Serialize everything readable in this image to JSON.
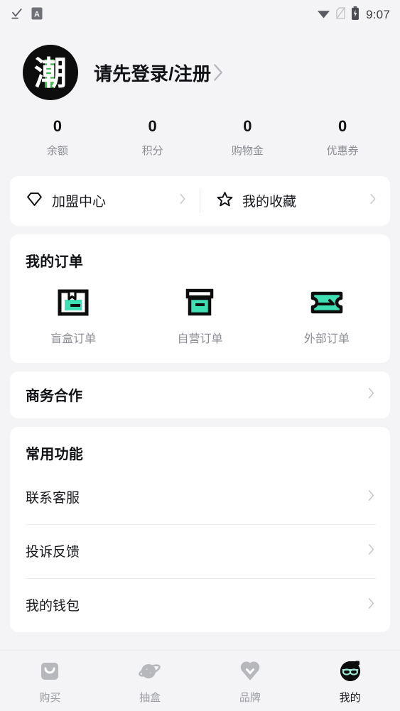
{
  "status_bar": {
    "icons_left": [
      "download-complete-icon",
      "app-badge-a-icon"
    ],
    "app_badge_letter": "A",
    "icons_right": [
      "wifi-icon",
      "no-sim-icon",
      "battery-charging-icon"
    ],
    "time": "9:07"
  },
  "profile": {
    "avatar_char": "潮",
    "avatar_bg": "#0d0d0d",
    "avatar_accent": "#3ebb4d",
    "login_label": "请先登录/注册",
    "chevron": "chevron-right-icon"
  },
  "stats": [
    {
      "value": "0",
      "label": "余额"
    },
    {
      "value": "0",
      "label": "积分"
    },
    {
      "value": "0",
      "label": "购物金"
    },
    {
      "value": "0",
      "label": "优惠券"
    }
  ],
  "quick_links": [
    {
      "label": "加盟中心",
      "icon": "diamond-icon"
    },
    {
      "label": "我的收藏",
      "icon": "star-icon"
    }
  ],
  "orders": {
    "title": "我的订单",
    "accent_color": "#3fdfb4",
    "items": [
      {
        "label": "盲盒订单",
        "icon": "package-box-icon"
      },
      {
        "label": "自营订单",
        "icon": "archive-box-icon"
      },
      {
        "label": "外部订单",
        "icon": "ticket-icon"
      }
    ]
  },
  "business": {
    "label": "商务合作"
  },
  "common": {
    "title": "常用功能",
    "items": [
      {
        "label": "联系客服"
      },
      {
        "label": "投诉反馈"
      },
      {
        "label": "我的钱包"
      }
    ]
  },
  "tabbar": {
    "active_index": 3,
    "items": [
      {
        "label": "购买",
        "icon": "shopping-bag-icon"
      },
      {
        "label": "抽盒",
        "icon": "planet-icon"
      },
      {
        "label": "品牌",
        "icon": "brand-pin-icon"
      },
      {
        "label": "我的",
        "icon": "profile-glasses-icon"
      }
    ]
  }
}
